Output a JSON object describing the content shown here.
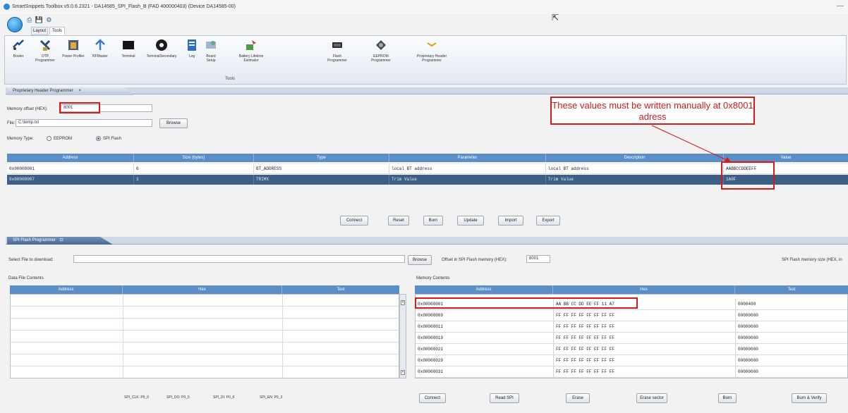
{
  "window": {
    "title": "SmartSnippets Toolbox v5.0.6.2321 - DA14585_SPI_Flash_B (FAD 400000403) (Device DA14585-00)"
  },
  "ribbon": {
    "tabs": [
      {
        "label": "Layout"
      },
      {
        "label": "Tools"
      }
    ],
    "group_label": "Tools",
    "tools": [
      {
        "label": "Booter",
        "icon": "booter-icon"
      },
      {
        "label": "OTP Programmer",
        "icon": "otp-programmer-icon"
      },
      {
        "label": "Power Profiler",
        "icon": "power-profiler-icon"
      },
      {
        "label": "RFMaster",
        "icon": "rfmaster-icon"
      },
      {
        "label": "Terminal",
        "icon": "terminal-icon"
      },
      {
        "label": "TerminalSecondary",
        "icon": "terminal-secondary-icon"
      },
      {
        "label": "Log",
        "icon": "log-icon"
      },
      {
        "label": "Board Setup",
        "icon": "board-setup-icon"
      },
      {
        "label": "Battery Lifetime Estimator",
        "icon": "battery-lifetime-icon"
      },
      {
        "label": "Flash Programmer",
        "icon": "flash-programmer-icon"
      },
      {
        "label": "EEPROM Programmer",
        "icon": "eeprom-programmer-icon"
      },
      {
        "label": "Proprietary Header Programmer",
        "icon": "proprietary-header-icon"
      }
    ]
  },
  "proprietary": {
    "tab_label": "Proprietary Header Programmer",
    "memory_offset_label": "Memory offset (HEX):",
    "memory_offset_value": "8001",
    "file_label": "File:",
    "file_value": "C:\\temp.txt",
    "browse_label": "Browse",
    "memory_type_label": "Memory Type:",
    "eeprom_label": "EEPROM",
    "spiflash_label": "SPI Flash",
    "annotation": "These values must be written manually at 0x8001 adress",
    "columns": [
      "Address",
      "Size (bytes)",
      "Type",
      "Parameter",
      "Description",
      "Value"
    ],
    "rows": [
      {
        "address": "0x00008001",
        "size": "6",
        "type": "BT_ADDRESS",
        "parameter": "local BT address",
        "description": "local BT address",
        "value": "AABBCCDDEEFF"
      },
      {
        "address": "0x00008007",
        "size": "1",
        "type": "TRIMX",
        "parameter": "Trim Value",
        "description": "Trim Value",
        "value": "1A0F"
      }
    ],
    "buttons": [
      "Connect",
      "Reset",
      "Burn",
      "Update",
      "Import",
      "Export"
    ]
  },
  "spi": {
    "tab_label": "SPI Flash Programmer",
    "select_file_label": "Select File to download:",
    "browse_label": "Browse",
    "offset_label": "Offset in SPI Flash memory (HEX):",
    "offset_value": "8001",
    "size_label": "SPI Flash memory size (HEX, in",
    "data_file_label": "Data File Contents",
    "data_columns": [
      "Address",
      "Hex",
      "Text"
    ],
    "memory_label": "Memory Contents",
    "memory_columns": [
      "Address",
      "Hex",
      "Text"
    ],
    "memory_rows": [
      {
        "address": "0x00008001",
        "hex": "AA BB CC DD EE FF 11 A7",
        "text": "0000400"
      },
      {
        "address": "0x00008009",
        "hex": "FF FF FF FF FF FF FF FF",
        "text": "00000000"
      },
      {
        "address": "0x00008011",
        "hex": "FF FF FF FF FF FF FF FF",
        "text": "00000000"
      },
      {
        "address": "0x00008019",
        "hex": "FF FF FF FF FF FF FF FF",
        "text": "00000000"
      },
      {
        "address": "0x00008021",
        "hex": "FF FF FF FF FF FF FF FF",
        "text": "00000000"
      },
      {
        "address": "0x00008029",
        "hex": "FF FF FF FF FF FF FF FF",
        "text": "00000000"
      },
      {
        "address": "0x00008031",
        "hex": "FF FF FF FF FF FF FF FF",
        "text": "00000000"
      }
    ],
    "pins": [
      "SPI_CLK: P0_0",
      "SPI_DO: P0_5",
      "SPI_DI: P0_6",
      "SPI_EN: P0_3"
    ],
    "buttons": [
      "Connect",
      "Read SPI",
      "Erase",
      "Erase sector",
      "Burn",
      "Burn & Verify"
    ]
  },
  "colors": {
    "header_blue": "#5b8ec6",
    "selected_row": "#3d5f85",
    "annotation_red": "#d41a1a"
  }
}
